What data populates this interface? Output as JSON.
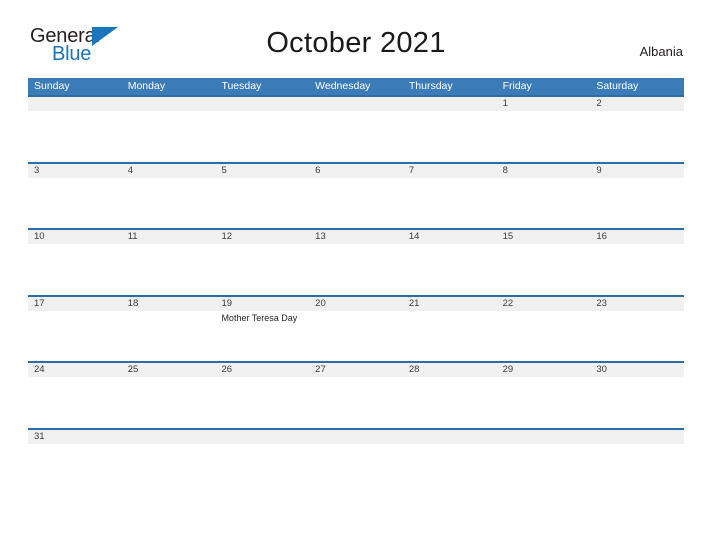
{
  "brand": {
    "name_part1": "General",
    "name_part2": "Blue",
    "accent_color": "#1b75bc"
  },
  "header": {
    "title": "October 2021",
    "country": "Albania"
  },
  "calendar": {
    "header_bg": "#3b7cb8",
    "row_divider_color": "#2e6da4",
    "date_band_bg": "#f0f0f0",
    "weekdays": [
      "Sunday",
      "Monday",
      "Tuesday",
      "Wednesday",
      "Thursday",
      "Friday",
      "Saturday"
    ],
    "weeks": [
      [
        {
          "date": ""
        },
        {
          "date": ""
        },
        {
          "date": ""
        },
        {
          "date": ""
        },
        {
          "date": ""
        },
        {
          "date": "1"
        },
        {
          "date": "2"
        }
      ],
      [
        {
          "date": "3"
        },
        {
          "date": "4"
        },
        {
          "date": "5"
        },
        {
          "date": "6"
        },
        {
          "date": "7"
        },
        {
          "date": "8"
        },
        {
          "date": "9"
        }
      ],
      [
        {
          "date": "10"
        },
        {
          "date": "11"
        },
        {
          "date": "12"
        },
        {
          "date": "13"
        },
        {
          "date": "14"
        },
        {
          "date": "15"
        },
        {
          "date": "16"
        }
      ],
      [
        {
          "date": "17"
        },
        {
          "date": "18"
        },
        {
          "date": "19",
          "event": "Mother Teresa Day"
        },
        {
          "date": "20"
        },
        {
          "date": "21"
        },
        {
          "date": "22"
        },
        {
          "date": "23"
        }
      ],
      [
        {
          "date": "24"
        },
        {
          "date": "25"
        },
        {
          "date": "26"
        },
        {
          "date": "27"
        },
        {
          "date": "28"
        },
        {
          "date": "29"
        },
        {
          "date": "30"
        }
      ],
      [
        {
          "date": "31"
        },
        {
          "date": ""
        },
        {
          "date": ""
        },
        {
          "date": ""
        },
        {
          "date": ""
        },
        {
          "date": ""
        },
        {
          "date": ""
        }
      ]
    ]
  }
}
